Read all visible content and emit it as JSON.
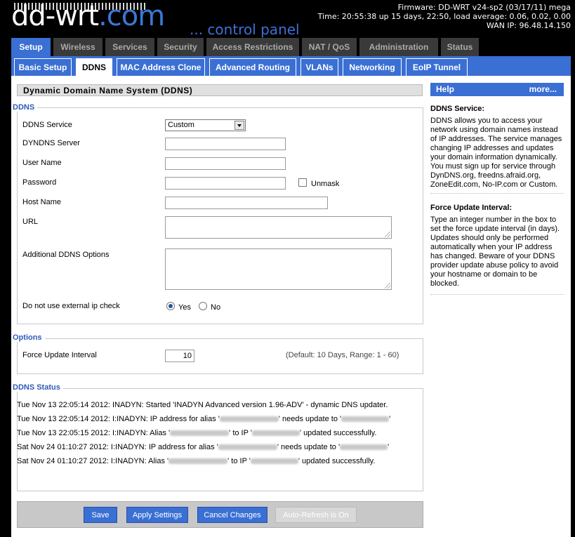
{
  "logo": {
    "main": "dd-wrt",
    "com": ".com",
    "tagline": "... control panel"
  },
  "router_info": {
    "firmware": "Firmware: DD-WRT v24-sp2 (03/17/11) mega",
    "time": "Time: 20:55:38 up 15 days, 22:50, load average: 0.06, 0.02, 0.00",
    "wan_ip": "WAN IP: 96.48.14.150"
  },
  "main_tabs": [
    "Setup",
    "Wireless",
    "Services",
    "Security",
    "Access Restrictions",
    "NAT / QoS",
    "Administration",
    "Status"
  ],
  "active_main_tab": "Setup",
  "sub_tabs": [
    "Basic Setup",
    "DDNS",
    "MAC Address Clone",
    "Advanced Routing",
    "VLANs",
    "Networking",
    "EoIP Tunnel"
  ],
  "active_sub_tab": "DDNS",
  "page_title": "Dynamic Domain Name System (DDNS)",
  "ddns": {
    "legend": "DDNS",
    "service_label": "DDNS Service",
    "service_value": "Custom",
    "server_label": "DYNDNS Server",
    "server_value": "",
    "user_label": "User Name",
    "user_value": "",
    "password_label": "Password",
    "password_value": "",
    "unmask_label": "Unmask",
    "unmask_checked": false,
    "host_label": "Host Name",
    "host_value": "",
    "url_label": "URL",
    "url_value": "",
    "options_label": "Additional DDNS Options",
    "options_value": "",
    "ext_ip_label": "Do not use external ip check",
    "yes_label": "Yes",
    "no_label": "No",
    "ext_ip_selected": "Yes"
  },
  "options": {
    "legend": "Options",
    "force_label": "Force Update Interval",
    "force_value": "10",
    "force_hint": "(Default: 10 Days, Range: 1 - 60)"
  },
  "status": {
    "legend": "DDNS Status",
    "lines": [
      {
        "pre": "Tue Nov 13 22:05:14 2012: INADYN: Started 'INADYN Advanced version 1.96-ADV' - dynamic DNS updater.",
        "blurs": []
      },
      {
        "pre": "Tue Nov 13 22:05:14 2012: I:INADYN: IP address for alias '",
        "mid": "' needs update to '",
        "post": "'",
        "blurs": [
          84,
          68
        ]
      },
      {
        "pre": "Tue Nov 13 22:05:15 2012: I:INADYN: Alias '",
        "mid": "' to IP '",
        "post": "' updated successfully.",
        "blurs": [
          84,
          68
        ]
      },
      {
        "pre": "Sat Nov 24 01:10:27 2012: I:INADYN: IP address for alias '",
        "mid": "' needs update to '",
        "post": "'",
        "blurs": [
          84,
          68
        ]
      },
      {
        "pre": "Sat Nov 24 01:10:27 2012: I:INADYN: Alias '",
        "mid": "' to IP '",
        "post": "' updated successfully.",
        "blurs": [
          84,
          68
        ]
      }
    ]
  },
  "buttons": {
    "save": "Save",
    "apply": "Apply Settings",
    "cancel": "Cancel Changes",
    "autorefresh": "Auto-Refresh is On"
  },
  "help": {
    "title": "Help",
    "more": "more...",
    "ddns_heading": "DDNS Service:",
    "ddns_text": "DDNS allows you to access your network using domain names instead of IP addresses. The service manages changing IP addresses and updates your domain information dynamically. You must sign up for service through DynDNS.org, freedns.afraid.org, ZoneEdit.com, No-IP.com or Custom.",
    "force_heading": "Force Update Interval:",
    "force_text": "Type an integer number in the box to set the force update interval (in days). Updates should only be performed automatically when your IP address has changed. Beware of your DDNS provider update abuse policy to avoid your hostname or domain to be blocked."
  },
  "colors": {
    "accent": "#3a6fd4",
    "legend": "#2f5bb7",
    "header_bg": "#000000",
    "tab_inactive": "#3a3a3a"
  }
}
